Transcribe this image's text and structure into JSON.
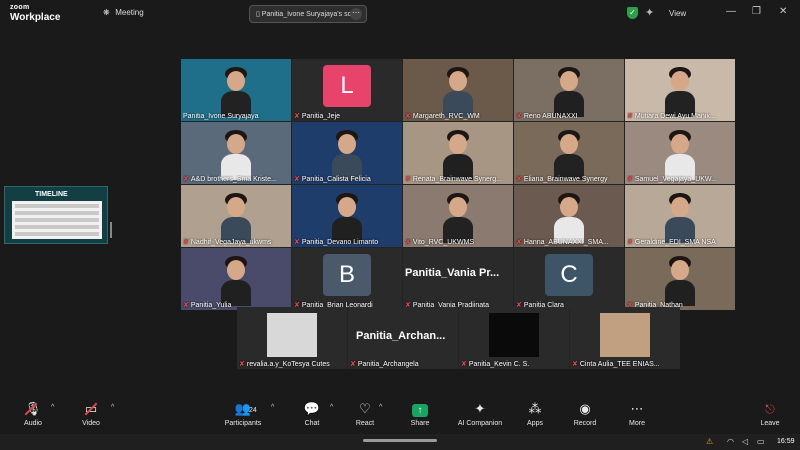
{
  "app": {
    "brand_top": "zoom",
    "brand_bottom": "Workplace"
  },
  "topbar": {
    "meeting_label": "Meeting",
    "share_pill_label": "Panitia_Ivone Suryajaya's scr",
    "share_pill_more": "···",
    "view_label": "View",
    "minimize": "—",
    "maximize": "❐",
    "close": "✕"
  },
  "shared_thumb": {
    "title": "TIMELINE"
  },
  "gallery": {
    "tiles": [
      {
        "name": "Panitia_Ivone Suryajaya",
        "muted": false,
        "active": true
      },
      {
        "name": "Panitia_Jeje",
        "muted": true,
        "letter": "L",
        "letter_color": "#e8436a"
      },
      {
        "name": "Margareth_RVC_WM",
        "muted": true
      },
      {
        "name": "Reno ABUNAXXI",
        "muted": true
      },
      {
        "name": "Mutiara Dewi Ayu Manik...",
        "muted": true
      },
      {
        "name": "A&D brothers_Sma Kriste...",
        "muted": true
      },
      {
        "name": "Panitia_Calista Felicia",
        "muted": true
      },
      {
        "name": "Renata_Brainwave Synerg...",
        "muted": true
      },
      {
        "name": "Eliana_Brainwave Synergy",
        "muted": true
      },
      {
        "name": "Samuel_Vegajaya_UKW...",
        "muted": true
      },
      {
        "name": "Nadhif_VegaJaya_ukwms",
        "muted": true
      },
      {
        "name": "Panitia_Devano Limanto",
        "muted": true
      },
      {
        "name": "Vito_RVC_UKWMS",
        "muted": true
      },
      {
        "name": "Hanna_ABUNAXXI_SMA...",
        "muted": true
      },
      {
        "name": "Geraldine_EDI_SMA NSA",
        "muted": true
      },
      {
        "name": "Panitia_Yulia",
        "muted": true
      },
      {
        "name": "Panitia_Brian Leonardi",
        "muted": true,
        "letter": "B",
        "letter_color": "#4a5a6a"
      },
      {
        "name": "Panitia_Vania Pradjinata",
        "muted": true,
        "big": "Panitia_Vania  Pr..."
      },
      {
        "name": "Panitia Clara",
        "muted": true,
        "letter": "C",
        "letter_color": "#3d5566"
      },
      {
        "name": "Panitia_Nathan",
        "muted": true
      }
    ],
    "row2": [
      {
        "name": "revalia.a.y_KoTesya Cutes",
        "muted": true
      },
      {
        "name": "Panitia_Archangela",
        "muted": true,
        "big": "Panitia_Archan..."
      },
      {
        "name": "Panitia_Kevin C. S.",
        "muted": true
      },
      {
        "name": "Cinta Aulia_TEE ENIAS...",
        "muted": true
      }
    ]
  },
  "toolbar": {
    "audio": "Audio",
    "video": "Video",
    "participants": "Participants",
    "participant_count": "24",
    "chat": "Chat",
    "react": "React",
    "share": "Share",
    "ai": "AI Companion",
    "apps": "Apps",
    "record": "Record",
    "more": "More",
    "leave": "Leave"
  },
  "taskbar": {
    "time": "16:59"
  }
}
